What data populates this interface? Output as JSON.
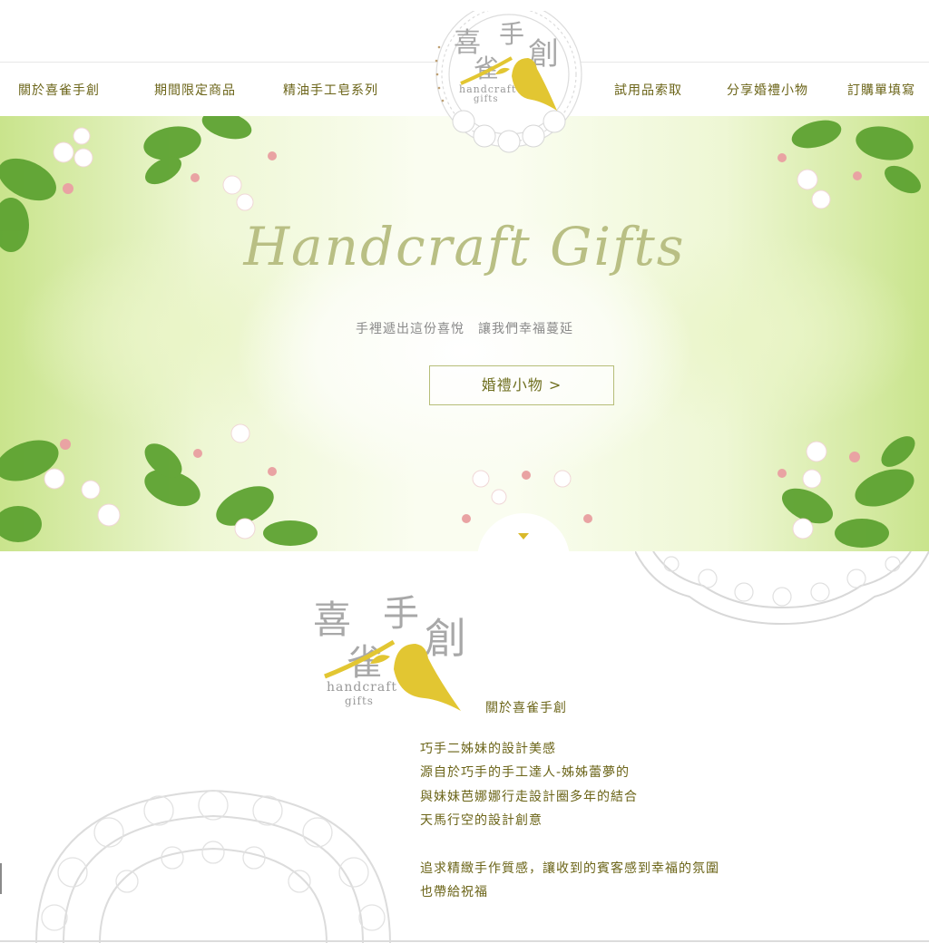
{
  "nav": {
    "items_left": [
      "關於喜雀手創",
      "期間限定商品",
      "精油手工皂系列"
    ],
    "items_right": [
      "試用品索取",
      "分享婚禮小物",
      "訂購單填寫"
    ]
  },
  "logo": {
    "chars": [
      "喜",
      "手",
      "雀",
      "創"
    ],
    "sub1": "handcraft",
    "sub2": "gifts",
    "brand_color": "#e2c632",
    "gray_color": "#a8a8a8"
  },
  "hero": {
    "title": "Handcraft Gifts",
    "subtitle": "手裡遞出這份喜悅　讓我們幸福蔓延",
    "button_label": "婚禮小物 >",
    "scroll_icon": "chevron-down-icon"
  },
  "about": {
    "heading": "關於喜雀手創",
    "lines": [
      "巧手二姊妹的設計美感",
      "源自於巧手的手工達人-姊姊蕾夢的",
      "與妹妹芭娜娜行走設計圈多年的結合",
      "天馬行空的設計創意",
      "",
      "追求精緻手作質感，讓收到的賓客感到幸福的氛圍",
      "也帶給祝福"
    ]
  },
  "colors": {
    "nav_text": "#6b6418",
    "hero_title": "#b9bf84",
    "accent_yellow": "#d9b92a"
  }
}
